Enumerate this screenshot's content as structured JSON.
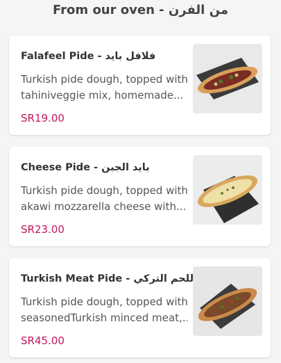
{
  "section": {
    "title": "From our oven - من الفرن"
  },
  "items": [
    {
      "name": "Falafeel Pide - فلافل بايد",
      "desc_line1": "Turkish pide dough, topped with",
      "desc_line2": "tahiniveggie mix, homemade...",
      "price": "SR19.00",
      "image_icon": "falafel-pide-photo"
    },
    {
      "name": "Cheese Pide - بايد الجبن",
      "desc_line1": "Turkish pide dough, topped with",
      "desc_line2": "akawi mozzarella cheese with...",
      "price": "SR23.00",
      "image_icon": "cheese-pide-photo"
    },
    {
      "name": "Turkish Meat Pide - بايد اللحم التركي",
      "desc_line1": "Turkish pide dough, topped with",
      "desc_line2": "seasonedTurkish minced meat,...",
      "price": "SR45.00",
      "image_icon": "meat-pide-photo"
    }
  ],
  "colors": {
    "price": "#c2185b",
    "background": "#f5f5f5",
    "card": "#ffffff"
  }
}
